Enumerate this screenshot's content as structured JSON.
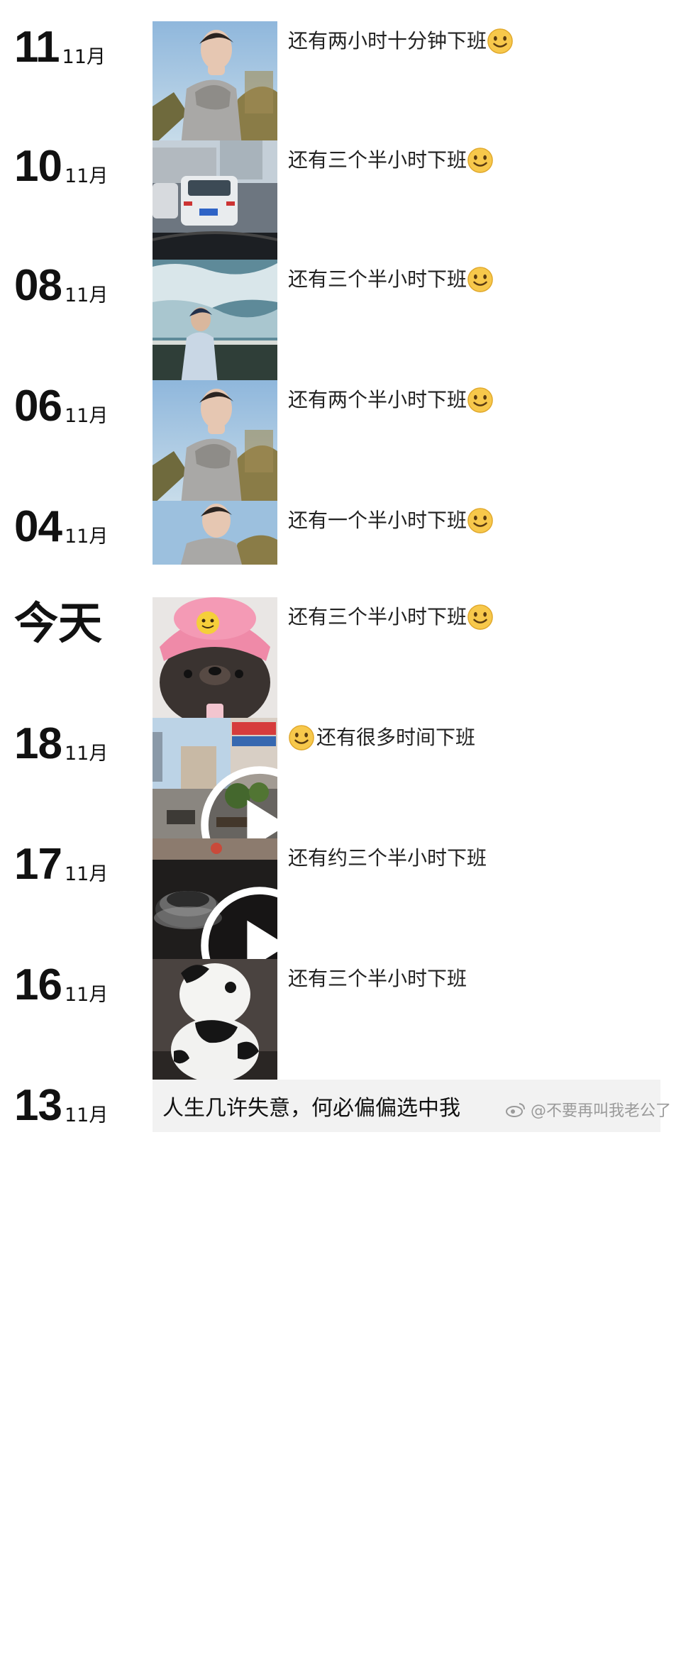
{
  "posts": [
    {
      "day": "11",
      "month": "11月",
      "caption": "还有两小时十分钟下班",
      "emoji": "smile-emoji",
      "thumb": "man-portrait-sweater"
    },
    {
      "day": "10",
      "month": "11月",
      "caption": "还有三个半小时下班",
      "emoji": "smile-emoji",
      "thumb": "car-traffic"
    },
    {
      "day": "08",
      "month": "11月",
      "caption": "还有三个半小时下班",
      "emoji": "smile-emoji",
      "thumb": "man-sky-clouds"
    },
    {
      "day": "06",
      "month": "11月",
      "caption": "还有两个半小时下班",
      "emoji": "smile-emoji",
      "thumb": "man-portrait-sweater"
    },
    {
      "day": "04",
      "month": "11月",
      "caption": "还有一个半小时下班",
      "emoji": "smile-emoji",
      "thumb": "man-portrait-sweater-cropped"
    },
    {
      "day": "今天",
      "month": "",
      "caption": "还有三个半小时下班",
      "emoji": "smile-emoji",
      "thumb": "bear-pink-hat"
    },
    {
      "day": "18",
      "month": "11月",
      "caption": "还有很多时间下班",
      "emoji": "smile-emoji-leading",
      "thumb": "street-video"
    },
    {
      "day": "17",
      "month": "11月",
      "caption": "还有约三个半小时下班",
      "emoji": "",
      "thumb": "car-dashboard-video"
    },
    {
      "day": "16",
      "month": "11月",
      "caption": "还有三个半小时下班",
      "emoji": "",
      "thumb": "cow-figurine"
    },
    {
      "day": "13",
      "month": "11月",
      "caption": "人生几许失意，何必偏偏选中我",
      "emoji": "",
      "thumb": ""
    }
  ],
  "watermark": {
    "text": "@不要再叫我老公了",
    "icon": "weibo-icon"
  },
  "colors": {
    "background": "#ffffff",
    "text": "#111111",
    "quote_box": "#f2f2f2"
  }
}
